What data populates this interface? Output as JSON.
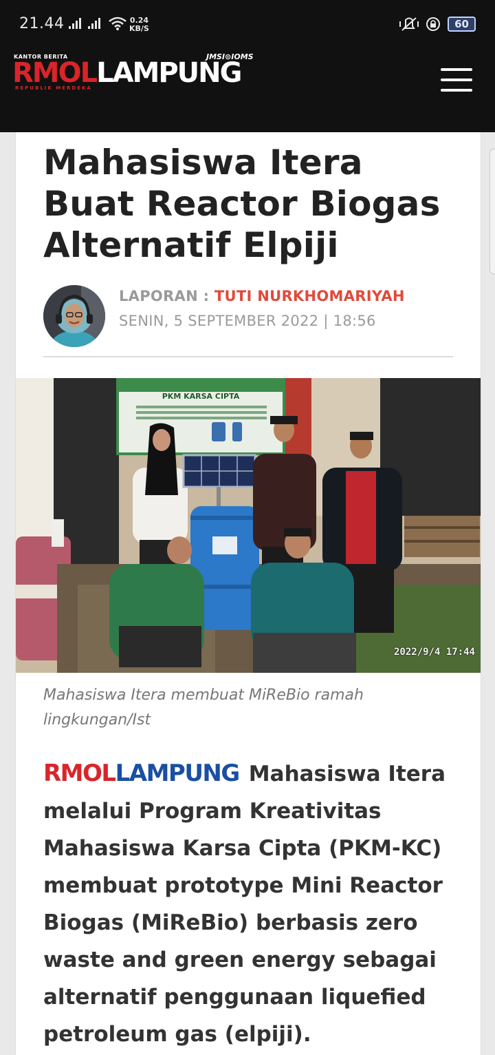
{
  "status_bar": {
    "time": "21.44",
    "net_speed_value": "0.24",
    "net_speed_unit": "KB/S",
    "battery": "60"
  },
  "header": {
    "logo_small_text": "KANTOR BERITA",
    "logo_red": "RMOL",
    "logo_white": "LAMPUNG",
    "logo_network": "JMSI⊙IOMS",
    "logo_tagline": "REPUBLIK MERDEKA"
  },
  "article": {
    "title": "Mahasiswa Itera Buat Reactor Biogas Alternatif Elpiji",
    "byline_label": "LAPORAN : ",
    "author": "TUTI NURKHOMARIYAH",
    "date": "SENIN, 5 SEPTEMBER 2022 | 18:56",
    "photo_timestamp": "2022/9/4 17:44",
    "photo_banner_title": "PKM KARSA CIPTA",
    "caption": "Mahasiswa Itera membuat MiReBio ramah lingkungan/Ist",
    "brand_red": "RMOL",
    "brand_blue": "LAMPUNG",
    "lead": "Mahasiswa Itera melalui Program Kreativitas Mahasiswa Karsa Cipta (PKM-KC) membuat prototype Mini Reactor Biogas (MiReBio) berbasis zero waste and green energy sebagai alternatif penggunaan liquefied petroleum gas (elpiji)."
  }
}
